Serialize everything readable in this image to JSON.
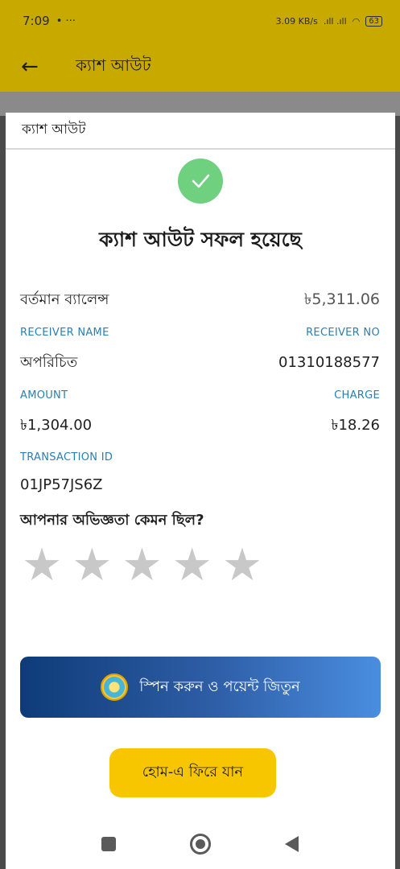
{
  "status_bar": {
    "time": "7:09",
    "extra": "•  ···",
    "net_speed": "3.09 KB/s",
    "signal": ".ıll .ıll",
    "battery": "63"
  },
  "app_bar": {
    "title": "ক্যাশ আউট"
  },
  "sheet": {
    "header": "ক্যাশ আউট",
    "headline": "ক্যাশ আউট সফল হয়েছে",
    "balance": {
      "label": "বর্তমান ব্যালেন্স",
      "value": "৳5,311.06"
    },
    "receiver": {
      "name_label": "RECEIVER NAME",
      "name_value": "অপরিচিত",
      "no_label": "RECEIVER NO",
      "no_value": "01310188577"
    },
    "amount": {
      "amount_label": "AMOUNT",
      "amount_value": "৳1,304.00",
      "charge_label": "CHARGE",
      "charge_value": "৳18.26"
    },
    "transaction": {
      "label": "TRANSACTION ID",
      "value": "01JP57JS6Z"
    },
    "rating": {
      "question": "আপনার অভিজ্ঞতা কেমন ছিল?",
      "stars": 5,
      "selected": 0
    },
    "spin_button": "স্পিন করুন ও পয়েন্ট জিতুন",
    "home_button": "হোম-এ ফিরে যান"
  },
  "colors": {
    "accent": "#c8a900",
    "success": "#6fd080",
    "label_blue": "#2a7fb0",
    "home_button": "#f7c600"
  }
}
